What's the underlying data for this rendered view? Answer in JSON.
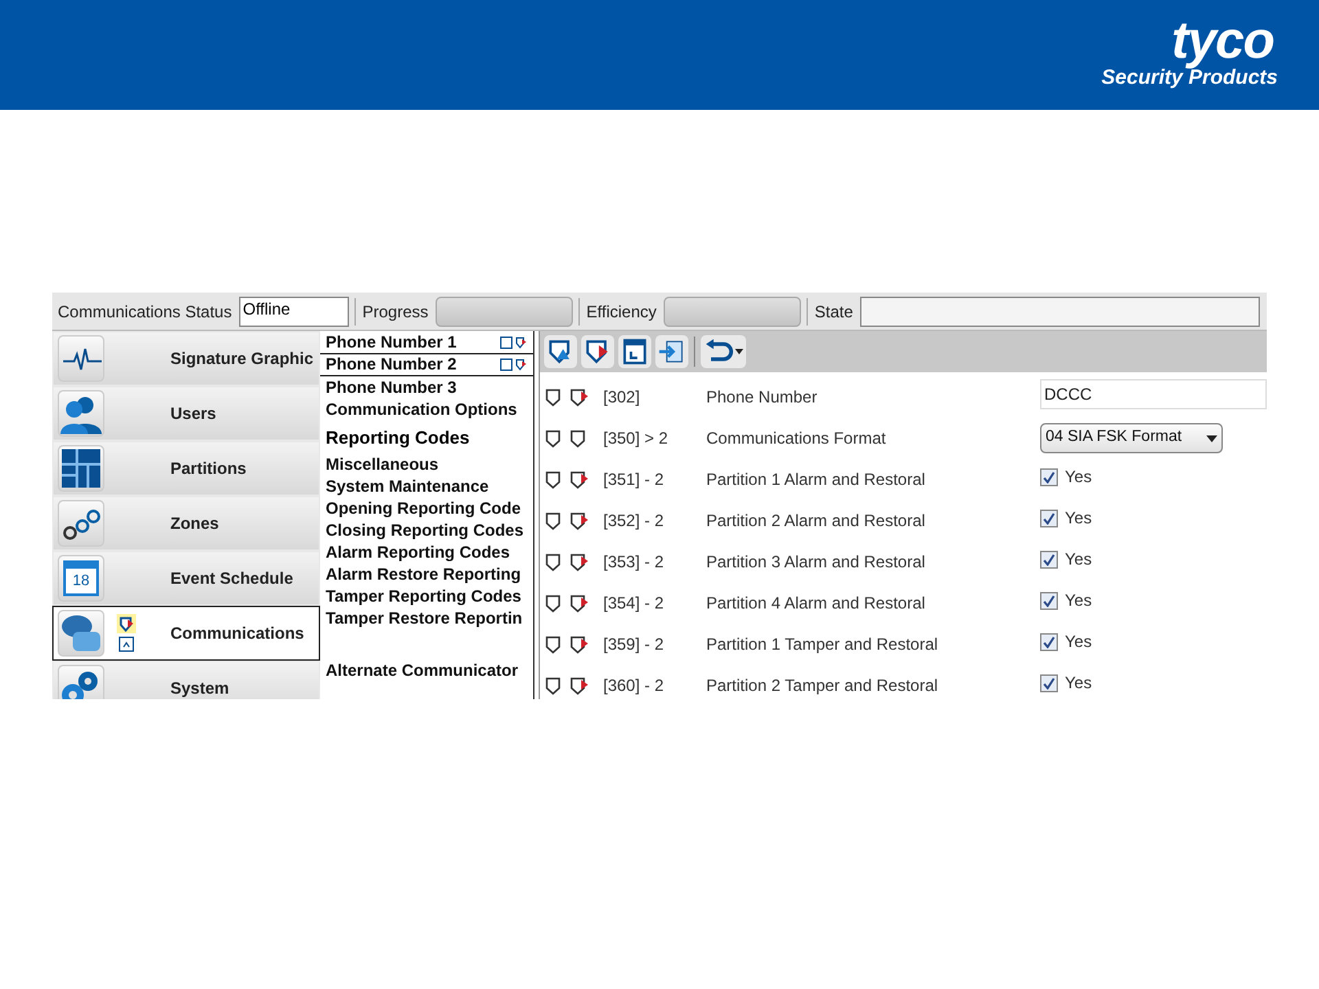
{
  "header": {
    "logo": "tyco",
    "tagline": "Security Products"
  },
  "status_bar": [
    {
      "label": "Communications Status",
      "value": "Offline",
      "kind": "text"
    },
    {
      "label": "Progress",
      "level": 0,
      "kind": "bar"
    },
    {
      "label": "Efficiency",
      "level": 0,
      "kind": "bar"
    },
    {
      "label": "State",
      "kind": "wide"
    }
  ],
  "nav": [
    {
      "label": "Signature Graphic",
      "selected": false
    },
    {
      "label": "Users",
      "selected": false
    },
    {
      "label": "Partitions",
      "selected": false
    },
    {
      "label": "Zones",
      "selected": false
    },
    {
      "label": "Event Schedule",
      "selected": false,
      "badge": "18"
    },
    {
      "label": "Communications",
      "selected": true
    },
    {
      "label": "System",
      "selected": false
    }
  ],
  "sections": [
    {
      "label": "Phone Number 1",
      "kind": "tab"
    },
    {
      "label": "Phone Number 2",
      "kind": "tab"
    },
    {
      "label": "Phone Number 3",
      "kind": "item"
    },
    {
      "label": "Communication Options",
      "kind": "item"
    },
    {
      "label": "Reporting Codes",
      "kind": "heading"
    },
    {
      "label": "Miscellaneous",
      "kind": "item"
    },
    {
      "label": "System Maintenance",
      "kind": "item"
    },
    {
      "label": "Opening  Reporting Code",
      "kind": "item"
    },
    {
      "label": "Closing Reporting Codes",
      "kind": "item"
    },
    {
      "label": "Alarm Reporting Codes",
      "kind": "item"
    },
    {
      "label": "Alarm Restore Reporting",
      "kind": "item"
    },
    {
      "label": "Tamper Reporting Codes",
      "kind": "item"
    },
    {
      "label": "Tamper  Restore Reportin",
      "kind": "item"
    },
    {
      "label": "Alternate Communicator",
      "kind": "gap-item"
    }
  ],
  "rows": [
    {
      "code": "[302]",
      "label": "Phone Number",
      "kind": "text",
      "value": "DCCC",
      "modified": true
    },
    {
      "code": "[350] > 2",
      "label": "Communications Format",
      "kind": "select",
      "value": "04 SIA FSK Format",
      "modified": false
    },
    {
      "code": "[351] - 2",
      "label": "Partition 1 Alarm and Restoral",
      "kind": "checkbox",
      "value": "Yes",
      "checked": true,
      "modified": true
    },
    {
      "code": "[352] - 2",
      "label": "Partition 2 Alarm and Restoral",
      "kind": "checkbox",
      "value": "Yes",
      "checked": true,
      "modified": true
    },
    {
      "code": "[353] - 2",
      "label": "Partition 3 Alarm and Restoral",
      "kind": "checkbox",
      "value": "Yes",
      "checked": true,
      "modified": true
    },
    {
      "code": "[354] - 2",
      "label": "Partition 4 Alarm and Restoral",
      "kind": "checkbox",
      "value": "Yes",
      "checked": true,
      "modified": true
    },
    {
      "code": "[359] - 2",
      "label": "Partition 1 Tamper and Restoral",
      "kind": "checkbox",
      "value": "Yes",
      "checked": true,
      "modified": true
    },
    {
      "code": "[360] - 2",
      "label": "Partition 2 Tamper and Restoral",
      "kind": "checkbox",
      "value": "Yes",
      "checked": true,
      "modified": true
    }
  ]
}
